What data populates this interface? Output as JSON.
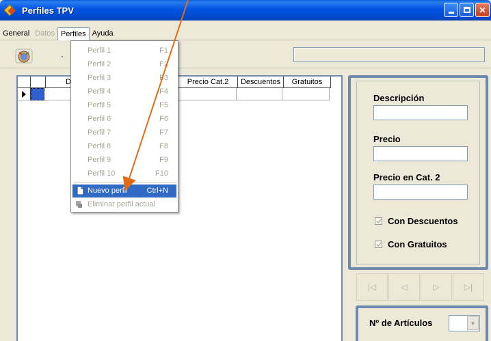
{
  "window": {
    "title": "Perfiles TPV"
  },
  "menubar": [
    {
      "label": "General",
      "enabled": true
    },
    {
      "label": "Datos",
      "enabled": false
    },
    {
      "label": "Perfiles",
      "enabled": true,
      "open": true
    },
    {
      "label": "Ayuda",
      "enabled": true
    }
  ],
  "grid": {
    "columns": [
      "De",
      "Precio Cat.2",
      "Descuentos",
      "Gratuitos"
    ]
  },
  "perfiles_menu": {
    "items": [
      {
        "label": "Perfil 1",
        "shortcut": "F1"
      },
      {
        "label": "Perfil 2",
        "shortcut": "F2"
      },
      {
        "label": "Perfil 3",
        "shortcut": "F3"
      },
      {
        "label": "Perfil 4",
        "shortcut": "F4"
      },
      {
        "label": "Perfil 5",
        "shortcut": "F5"
      },
      {
        "label": "Perfil 6",
        "shortcut": "F6"
      },
      {
        "label": "Perfil 7",
        "shortcut": "F7"
      },
      {
        "label": "Perfil 8",
        "shortcut": "F8"
      },
      {
        "label": "Perfil 9",
        "shortcut": "F9"
      },
      {
        "label": "Perfil 10",
        "shortcut": "F10"
      }
    ],
    "nuevo": {
      "label": "Nuevo perfil",
      "shortcut": "Ctrl+N"
    },
    "eliminar": {
      "label": "Eliminar perfil actual"
    }
  },
  "form": {
    "descripcion_label": "Descripción",
    "precio_label": "Precio",
    "precio_cat2_label": "Precio en Cat. 2",
    "con_descuentos_label": "Con Descuentos",
    "con_gratuitos_label": "Con Gratuitos",
    "num_articulos_label": "Nº de Artículos"
  },
  "colors": {
    "titlebar": "#0054e3",
    "highlight": "#316ac5",
    "annotation_arrow": "#e36b14"
  }
}
